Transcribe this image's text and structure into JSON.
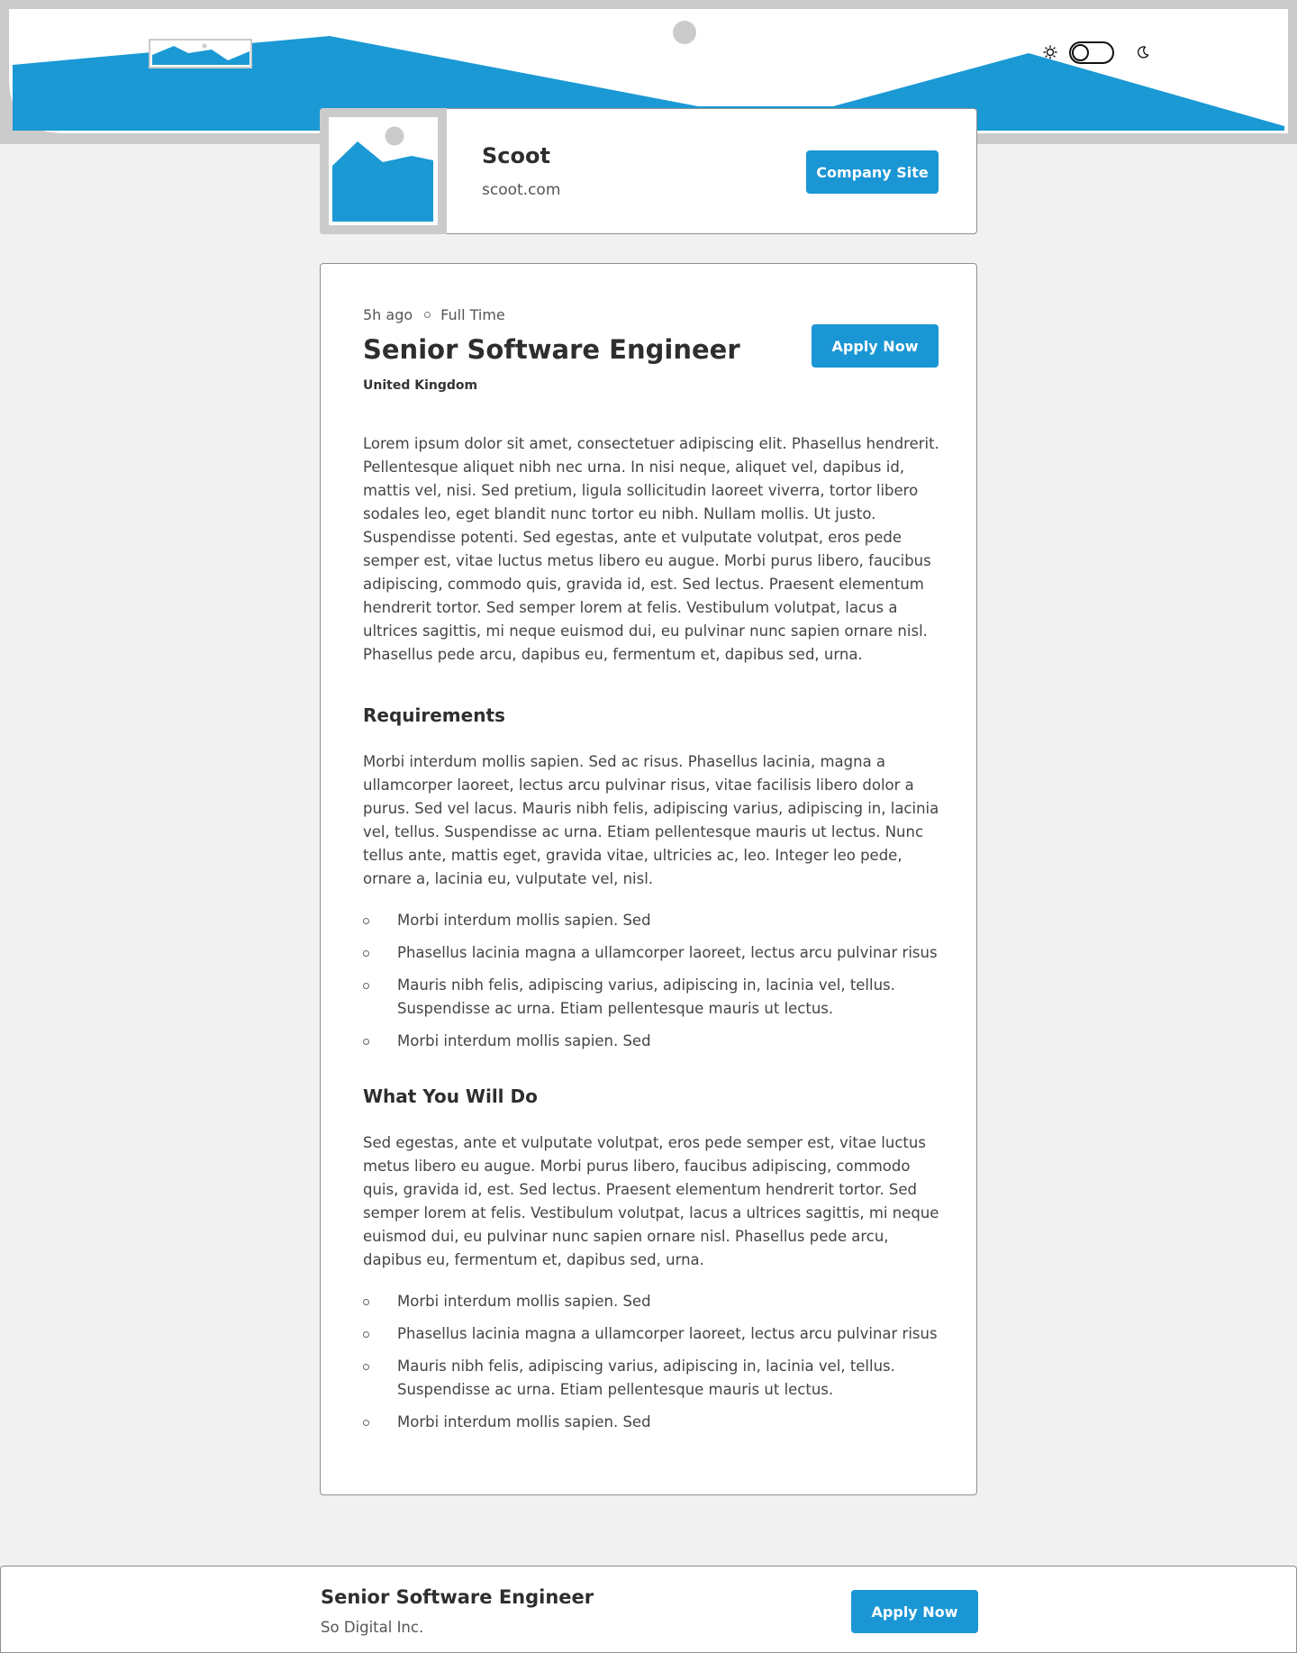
{
  "header": {
    "logo_icon": "image-placeholder-icon",
    "theme": {
      "light_icon": "sun-icon",
      "dark_icon": "moon-icon",
      "toggle_state": "light"
    }
  },
  "company": {
    "logo_icon": "image-placeholder-icon",
    "name": "Scoot",
    "domain": "scoot.com",
    "site_button_label": "Company Site"
  },
  "job": {
    "posted": "5h ago",
    "contract": "Full Time",
    "title": "Senior Software Engineer",
    "location": "United Kingdom",
    "apply_label": "Apply Now",
    "description": "Lorem ipsum dolor sit amet, consectetuer adipiscing elit. Phasellus hendrerit. Pellentesque aliquet nibh nec urna. In nisi neque, aliquet vel, dapibus id, mattis vel, nisi. Sed pretium, ligula sollicitudin laoreet viverra, tortor libero sodales leo, eget blandit nunc tortor eu nibh. Nullam mollis. Ut justo. Suspendisse potenti. Sed egestas, ante et vulputate volutpat, eros pede semper est, vitae luctus metus libero eu augue. Morbi purus libero, faucibus adipiscing, commodo quis, gravida id, est. Sed lectus. Praesent elementum hendrerit tortor. Sed semper lorem at felis. Vestibulum volutpat, lacus a ultrices sagittis, mi neque euismod dui, eu pulvinar nunc sapien ornare nisl. Phasellus pede arcu, dapibus eu, fermentum et, dapibus sed, urna.",
    "requirements": {
      "heading": "Requirements",
      "content": "Morbi interdum mollis sapien. Sed ac risus. Phasellus lacinia, magna a ullamcorper laoreet, lectus arcu pulvinar risus, vitae facilisis libero dolor a purus. Sed vel lacus. Mauris nibh felis, adipiscing varius, adipiscing in, lacinia vel, tellus. Suspendisse ac urna. Etiam pellentesque mauris ut lectus. Nunc tellus ante, mattis eget, gravida vitae, ultricies ac, leo. Integer leo pede, ornare a, lacinia eu, vulputate vel, nisl.",
      "items": [
        "Morbi interdum mollis sapien. Sed",
        "Phasellus lacinia magna a ullamcorper laoreet, lectus arcu pulvinar risus",
        "Mauris nibh felis, adipiscing varius, adipiscing in, lacinia vel, tellus. Suspendisse ac urna. Etiam pellentesque mauris ut lectus.",
        "Morbi interdum mollis sapien. Sed"
      ]
    },
    "role": {
      "heading": "What You Will Do",
      "content": "Sed egestas, ante et vulputate volutpat, eros pede semper est, vitae luctus metus libero eu augue. Morbi purus libero, faucibus adipiscing, commodo quis, gravida id, est. Sed lectus. Praesent elementum hendrerit tortor. Sed semper lorem at felis. Vestibulum volutpat, lacus a ultrices sagittis, mi neque euismod dui, eu pulvinar nunc sapien ornare nisl. Phasellus pede arcu, dapibus eu, fermentum et, dapibus sed, urna.",
      "items": [
        "Morbi interdum mollis sapien. Sed",
        "Phasellus lacinia magna a ullamcorper laoreet, lectus arcu pulvinar risus",
        "Mauris nibh felis, adipiscing varius, adipiscing in, lacinia vel, tellus. Suspendisse ac urna. Etiam pellentesque mauris ut lectus.",
        "Morbi interdum mollis sapien. Sed"
      ]
    }
  },
  "footer": {
    "title": "Senior Software Engineer",
    "company": "So Digital Inc.",
    "apply_label": "Apply Now"
  },
  "colors": {
    "accent": "#1a96d4",
    "placeholder_gray": "#cbcbcb",
    "page_background": "#f1f1f1"
  }
}
